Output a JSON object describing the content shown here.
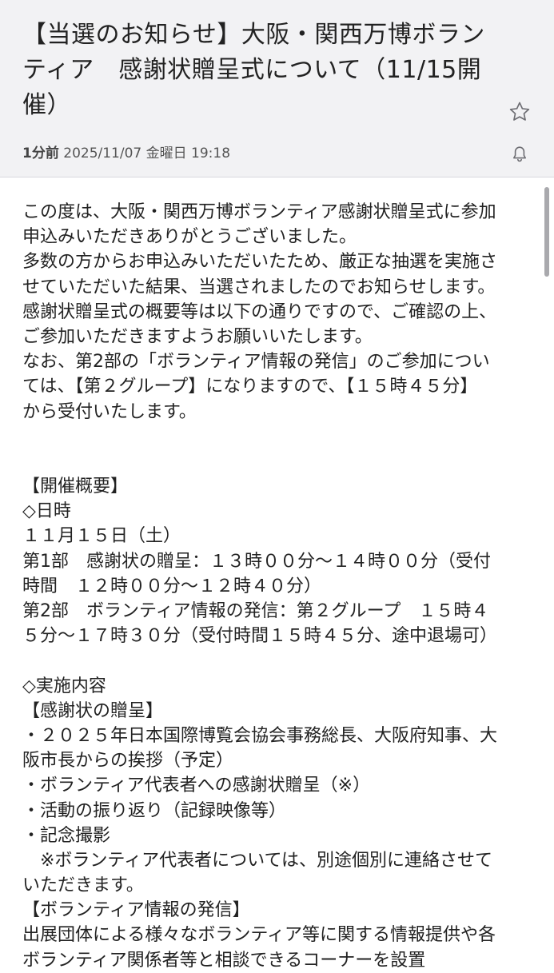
{
  "header": {
    "subject": "【当選のお知らせ】大阪・関西万博ボランティア　感謝状贈呈式について（11/15開催）",
    "time_ago": "1分前",
    "datetime": "2025/11/07 金曜日 19:18",
    "star_icon": "star-outline-icon",
    "bell_icon": "bell-outline-icon"
  },
  "body": {
    "lines": [
      "この度は、大阪・関西万博ボランティア感謝状贈呈式に参加",
      "申込みいただきありがとうございました。",
      "多数の方からお申込みいただいたため、厳正な抽選を実施さ",
      "せていただいた結果、当選されましたのでお知らせします。",
      "感謝状贈呈式の概要等は以下の通りですので、ご確認の上、",
      "ご参加いただきますようお願いいたします。",
      "なお、第2部の「ボランティア情報の発信」のご参加につい",
      "ては、【第２グループ】になりますので、【１５時４５分】",
      "から受付いたします。",
      "",
      "",
      "【開催概要】",
      "◇日時",
      "１１月１５日（土）",
      "第1部　感謝状の贈呈：１３時００分〜１４時００分（受付",
      "時間　１２時００分〜１２時４０分）",
      "第2部　ボランティア情報の発信：第２グループ　１５時４",
      "５分〜１７時３０分（受付時間１５時４５分、途中退場可）",
      "",
      "◇実施内容",
      "【感謝状の贈呈】",
      "・２０２５年日本国際博覧会協会事務総長、大阪府知事、大",
      "阪市長からの挨拶（予定）",
      "・ボランティア代表者への感謝状贈呈（※）",
      "・活動の振り返り（記録映像等）",
      "・記念撮影",
      "　※ボランティア代表者については、別途個別に連絡させて",
      "いただきます。",
      "【ボランティア情報の発信】",
      "出展団体による様々なボランティア等に関する情報提供や各",
      "ボランティア関係者等と相談できるコーナーを設置"
    ]
  }
}
